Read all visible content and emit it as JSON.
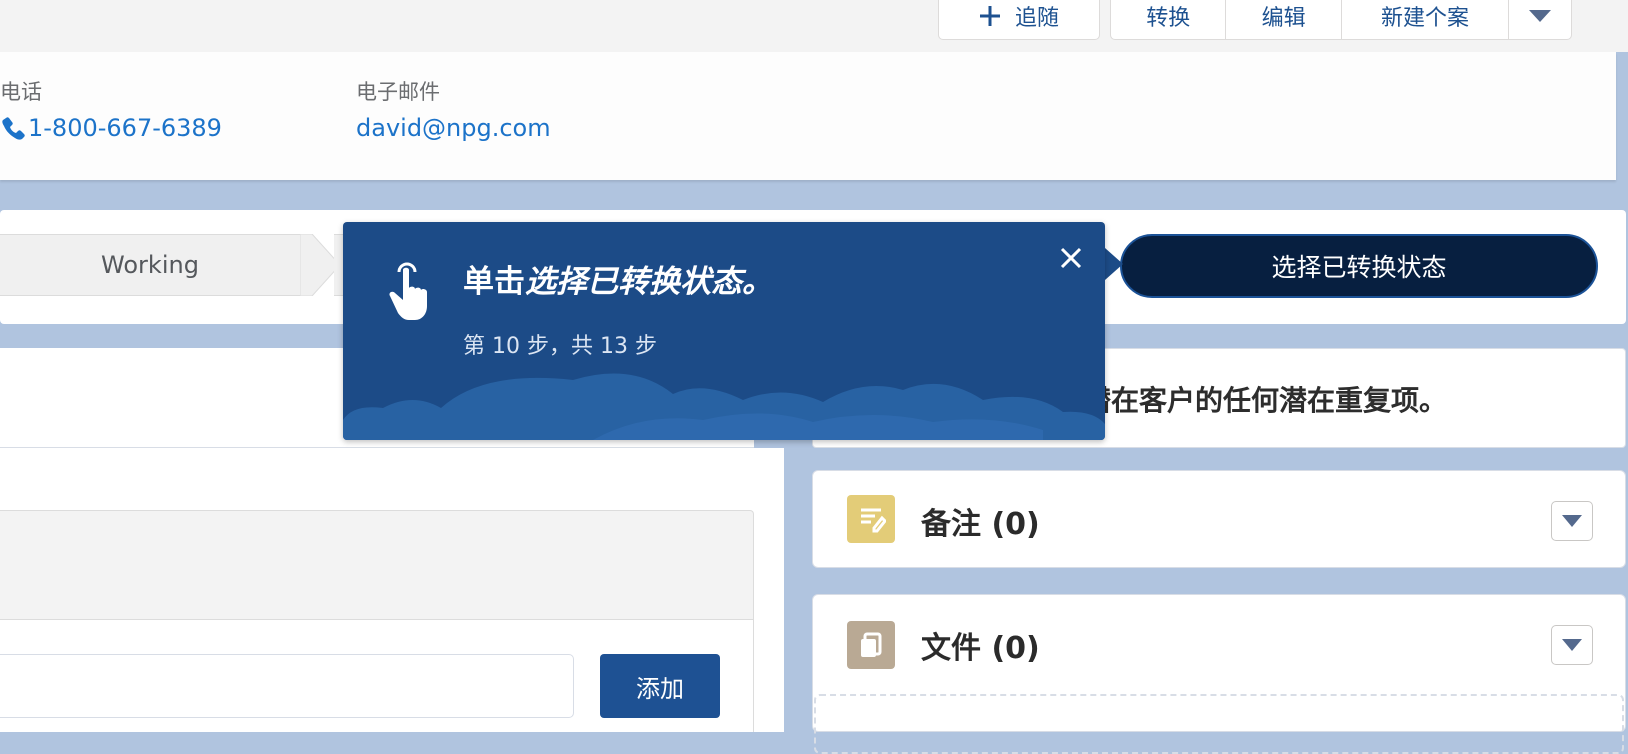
{
  "header": {
    "buttons": [
      {
        "label": "追随",
        "icon": "plus-icon"
      },
      {
        "label": "转换"
      },
      {
        "label": "编辑"
      },
      {
        "label": "新建个案"
      }
    ],
    "more_icon": "chevron-down-icon"
  },
  "highlights": {
    "phone_label": "电话",
    "phone_value": "1-800-667-6389",
    "email_label": "电子邮件",
    "email_value": "david@npg.com"
  },
  "path": {
    "stage": "Working",
    "action_label": "选择已转换状态"
  },
  "tooltip": {
    "title_prefix": "单击",
    "title_emphasis": "选择已转换状态。",
    "step_text": "第 10 步，共 13 步",
    "icon": "hand-pointer-icon"
  },
  "duplicates": {
    "text": "潜在客户的任何潜在重复项。"
  },
  "related": [
    {
      "title": "备注 (0)",
      "icon": "note-icon",
      "color": "#e3cc78"
    },
    {
      "title": "文件 (0)",
      "icon": "file-icon",
      "color": "#b9a994"
    }
  ],
  "composer": {
    "add_label": "添加"
  }
}
